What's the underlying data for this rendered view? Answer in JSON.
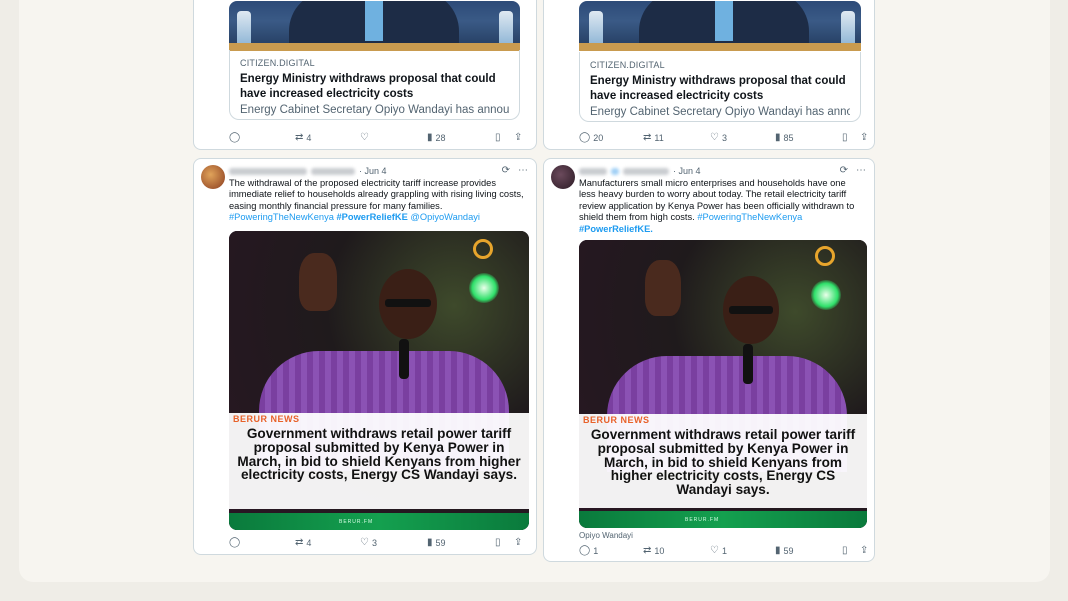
{
  "colors": {
    "link": "#1d9bf0",
    "muted": "#536471",
    "brand_orange": "#e8622a",
    "banner_green": "#14a04f"
  },
  "top_cards": [
    {
      "preview": {
        "source": "CITIZEN.DIGITAL",
        "title": "Energy Ministry withdraws proposal that could have increased electricity costs",
        "description": "Energy Cabinet Secretary Opiyo Wandayi has annou..."
      },
      "actions": {
        "reply": "",
        "repost": "4",
        "like": "",
        "views": "28"
      }
    },
    {
      "preview": {
        "source": "CITIZEN.DIGITAL",
        "title": "Energy Ministry withdraws proposal that could have increased electricity costs",
        "description": "Energy Cabinet Secretary Opiyo Wandayi has annou..."
      },
      "actions": {
        "reply": "20",
        "repost": "11",
        "like": "3",
        "views": "85"
      }
    }
  ],
  "posts": [
    {
      "date": "· Jun 4",
      "text": "The withdrawal of the proposed electricity tariff increase provides immediate relief to households already grappling with rising living costs, easing monthly financial pressure for many families.",
      "hashtags": [
        "#PoweringTheNewKenya",
        "#PowerReliefKE",
        "@OpiyoWandayi"
      ],
      "media": {
        "brand": "BERUR NEWS",
        "headline": "Government withdraws retail power tariff proposal submitted by Kenya Power in March, in bid to shield Kenyans from higher electricity costs, Energy CS Wandayi says.",
        "footer": "BERUR.FM"
      },
      "actions": {
        "reply": "",
        "repost": "4",
        "like": "3",
        "views": "59"
      }
    },
    {
      "date": "· Jun 4",
      "text": "Manufacturers small micro enterprises and households have one less heavy burden to worry about today. The retail electricity tariff review application by Kenya Power has been officially withdrawn to shield them from high costs.",
      "hashtags": [
        "#PoweringTheNewKenya",
        "#PowerReliefKE."
      ],
      "media": {
        "brand": "BERUR NEWS",
        "headline": "Government withdraws retail power tariff proposal submitted by Kenya Power in March, in bid to shield Kenyans from higher electricity costs, Energy CS Wandayi says.",
        "footer": "BERUR.FM"
      },
      "credit": "Opiyo Wandayi",
      "actions": {
        "reply": "1",
        "repost": "10",
        "like": "1",
        "views": "59"
      }
    }
  ],
  "icons": [
    "reply-icon",
    "repost-icon",
    "like-icon",
    "views-icon",
    "bookmark-icon",
    "share-icon",
    "grok-icon",
    "more-icon"
  ]
}
